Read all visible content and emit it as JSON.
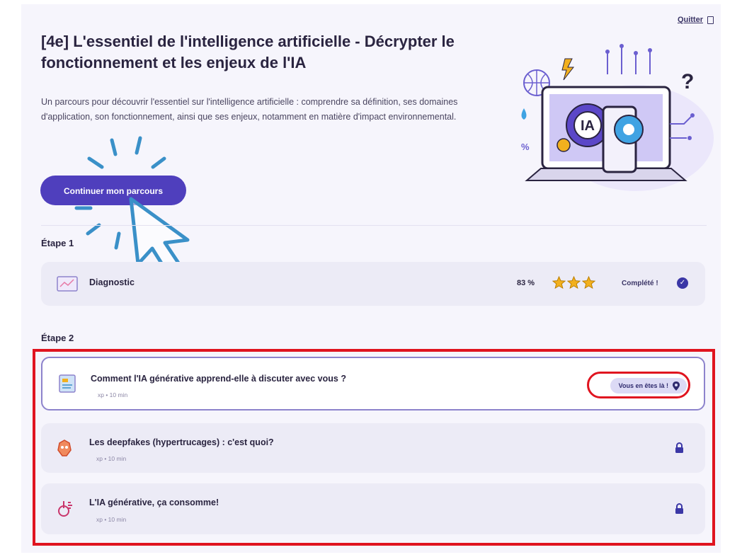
{
  "header": {
    "quit_label": "Quitter",
    "title": "[4e] L'essentiel de l'intelligence artificielle - Décrypter le fonctionnement et les enjeux de l'IA",
    "description": "Un parcours pour découvrir l'essentiel sur l'intelligence artificielle : comprendre sa définition, ses domaines d'application, son fonctionnement, ainsi que ses enjeux, notamment en matière d'impact environnemental.",
    "cta_label": "Continuer mon parcours"
  },
  "illustration": {
    "center_text": "IA",
    "question_mark": "?",
    "percent": "%"
  },
  "steps": [
    {
      "label": "Étape 1",
      "items": [
        {
          "title": "Diagnostic",
          "score": "83 %",
          "stars": 3,
          "status": "Complété !",
          "icon": "chart-icon"
        }
      ]
    },
    {
      "label": "Étape 2",
      "items": [
        {
          "title": "Comment l'IA générative apprend-elle à discuter avec vous ?",
          "meta": "xp • 10 min",
          "status": "Vous en êtes là !",
          "icon": "document-icon"
        },
        {
          "title": "Les deepfakes (hypertrucages) : c'est quoi?",
          "meta": "xp • 10 min",
          "icon": "deepfake-icon",
          "locked": true
        },
        {
          "title": "L'IA générative, ça consomme!",
          "meta": "xp • 10 min",
          "icon": "energy-icon",
          "locked": true
        }
      ]
    }
  ],
  "colors": {
    "accent": "#4f3fbd",
    "highlight": "#e0141f",
    "star": "#f2b01e"
  }
}
